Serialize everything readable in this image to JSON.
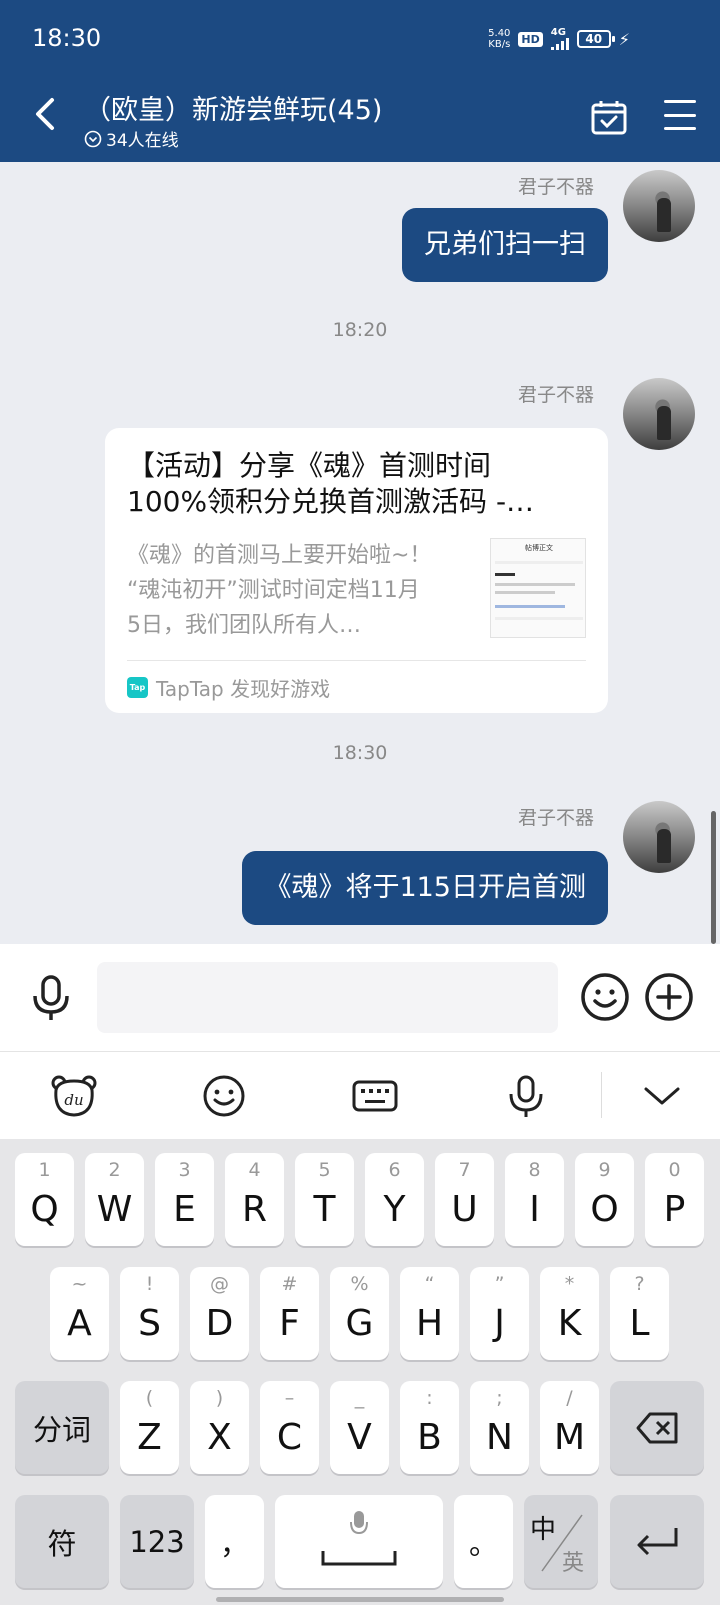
{
  "status_bar": {
    "time": "18:30",
    "net_speed_value": "5.40",
    "net_speed_unit": "KB/s",
    "hd": "HD",
    "network": "4G",
    "battery": "40"
  },
  "header": {
    "title": "（欧皇）新游尝鲜玩(45)",
    "online": "34人在线"
  },
  "messages": [
    {
      "sender": "君子不器",
      "text": "兄弟们扫一扫"
    },
    {
      "timestamp": "18:20"
    },
    {
      "sender": "君子不器",
      "card": {
        "title_line1": "【活动】分享《魂》首测时间",
        "title_line2": "100%领积分兑换首测激活码 -…",
        "desc_line1": "《魂》的首测马上要开始啦~！",
        "desc_line2": "“魂沌初开”测试时间定档11月",
        "desc_line3": "5日，我们团队所有人…",
        "thumb_title": "帖博正文",
        "source_logo": "Tap",
        "source": "TapTap 发现好游戏"
      }
    },
    {
      "timestamp": "18:30"
    },
    {
      "sender": "君子不器",
      "text": "《魂》将于115日开启首测"
    }
  ],
  "input": {
    "placeholder": ""
  },
  "keyboard": {
    "row1": [
      {
        "sub": "1",
        "main": "Q"
      },
      {
        "sub": "2",
        "main": "W"
      },
      {
        "sub": "3",
        "main": "E"
      },
      {
        "sub": "4",
        "main": "R"
      },
      {
        "sub": "5",
        "main": "T"
      },
      {
        "sub": "6",
        "main": "Y"
      },
      {
        "sub": "7",
        "main": "U"
      },
      {
        "sub": "8",
        "main": "I"
      },
      {
        "sub": "9",
        "main": "O"
      },
      {
        "sub": "0",
        "main": "P"
      }
    ],
    "row2": [
      {
        "sub": "~",
        "main": "A"
      },
      {
        "sub": "!",
        "main": "S"
      },
      {
        "sub": "@",
        "main": "D"
      },
      {
        "sub": "#",
        "main": "F"
      },
      {
        "sub": "%",
        "main": "G"
      },
      {
        "sub": "“",
        "main": "H"
      },
      {
        "sub": "”",
        "main": "J"
      },
      {
        "sub": "*",
        "main": "K"
      },
      {
        "sub": "?",
        "main": "L"
      }
    ],
    "row3": [
      {
        "sub": "(",
        "main": "Z"
      },
      {
        "sub": ")",
        "main": "X"
      },
      {
        "sub": "–",
        "main": "C"
      },
      {
        "sub": "_",
        "main": "V"
      },
      {
        "sub": ":",
        "main": "B"
      },
      {
        "sub": ";",
        "main": "N"
      },
      {
        "sub": "/",
        "main": "M"
      }
    ],
    "segment_key": "分词",
    "symbol_key": "符",
    "number_key": "123",
    "comma_key": "，",
    "period_key": "。",
    "lang_zh": "中",
    "lang_en": "英"
  },
  "icons": {
    "back": "chevron-left-icon",
    "calendar": "calendar-check-icon",
    "menu": "hamburger-menu-icon",
    "voice": "microphone-icon",
    "emoji": "smiley-icon",
    "plus": "plus-circle-icon"
  },
  "colors": {
    "header_bg": "#1c4a82",
    "bubble_bg": "#1c4a82",
    "chat_bg": "#ebedf2",
    "keyboard_bg": "#e6e6e8"
  }
}
